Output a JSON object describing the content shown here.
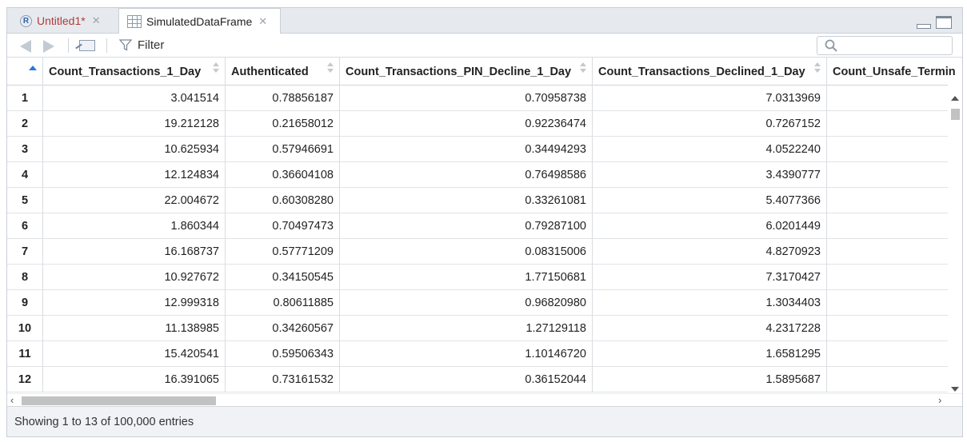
{
  "tabs": [
    {
      "label": "Untitled1*",
      "icon": "r-script-icon"
    },
    {
      "label": "SimulatedDataFrame",
      "icon": "data-grid-icon"
    }
  ],
  "toolbar": {
    "filter_label": "Filter",
    "search_placeholder": ""
  },
  "table": {
    "columns": [
      "Count_Transactions_1_Day",
      "Authenticated",
      "Count_Transactions_PIN_Decline_1_Day",
      "Count_Transactions_Declined_1_Day",
      "Count_Unsafe_Terminal"
    ],
    "rows": [
      {
        "n": "1",
        "v": [
          "3.041514",
          "0.78856187",
          "0.70958738",
          "7.0313969"
        ]
      },
      {
        "n": "2",
        "v": [
          "19.212128",
          "0.21658012",
          "0.92236474",
          "0.7267152"
        ]
      },
      {
        "n": "3",
        "v": [
          "10.625934",
          "0.57946691",
          "0.34494293",
          "4.0522240"
        ]
      },
      {
        "n": "4",
        "v": [
          "12.124834",
          "0.36604108",
          "0.76498586",
          "3.4390777"
        ]
      },
      {
        "n": "5",
        "v": [
          "22.004672",
          "0.60308280",
          "0.33261081",
          "5.4077366"
        ]
      },
      {
        "n": "6",
        "v": [
          "1.860344",
          "0.70497473",
          "0.79287100",
          "6.0201449"
        ]
      },
      {
        "n": "7",
        "v": [
          "16.168737",
          "0.57771209",
          "0.08315006",
          "4.8270923"
        ]
      },
      {
        "n": "8",
        "v": [
          "10.927672",
          "0.34150545",
          "1.77150681",
          "7.3170427"
        ]
      },
      {
        "n": "9",
        "v": [
          "12.999318",
          "0.80611885",
          "0.96820980",
          "1.3034403"
        ]
      },
      {
        "n": "10",
        "v": [
          "11.138985",
          "0.34260567",
          "1.27129118",
          "4.2317228"
        ]
      },
      {
        "n": "11",
        "v": [
          "15.420541",
          "0.59506343",
          "1.10146720",
          "1.6581295"
        ]
      },
      {
        "n": "12",
        "v": [
          "16.391065",
          "0.73161532",
          "0.36152044",
          "1.5895687"
        ]
      }
    ]
  },
  "status": {
    "text": "Showing 1 to 13 of 100,000 entries"
  }
}
